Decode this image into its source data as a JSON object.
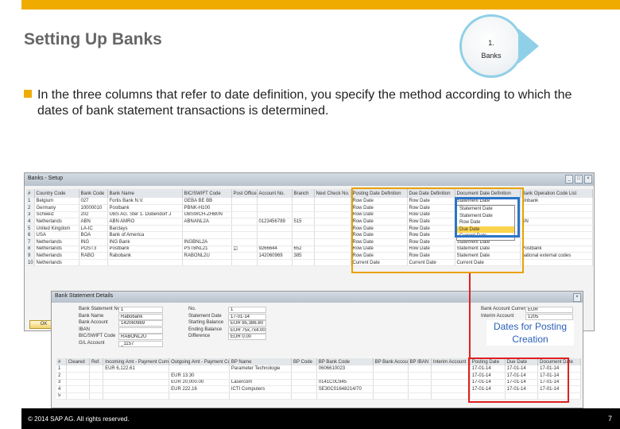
{
  "slide": {
    "title": "Setting Up Banks",
    "step_number": "1.",
    "step_label": "Banks",
    "bullet_text": "In the three columns that refer to date definition, you specify the method according to which the dates of bank statement transactions is determined.",
    "callout": "Dates for Posting Creation",
    "footer_left": "© 2014 SAP AG. All rights reserved.",
    "page_number": "7"
  },
  "colors": {
    "accent": "#f0ab00",
    "highlight_blue": "#2b74c7",
    "highlight_red": "#e02020",
    "callout_text": "#2b5fb7"
  },
  "banks_window": {
    "title": "Banks - Setup",
    "ok_label": "OK",
    "columns": [
      "#",
      "Country Code",
      "Bank Code",
      "Bank Name",
      "BIC/SWIFT Code",
      "Post Office",
      "Account No.",
      "Branch",
      "Next Check No.",
      "Posting Date Definition",
      "Due Date Definition",
      "Document Date Definition",
      "Bank Operation Code List"
    ],
    "rows": [
      [
        "1",
        "Belgium",
        "027",
        "Fortis Bank N.V.",
        "GEBA BE BB",
        "",
        "",
        "",
        "",
        "Row Date",
        "Row Date",
        "Statement Date",
        "Unbank"
      ],
      [
        "2",
        "Germany",
        "10000010",
        "Postbank",
        "PBNK-H100",
        "",
        "",
        "",
        "",
        "Row Date",
        "Row Date",
        "",
        ""
      ],
      [
        "3",
        "Schweiz",
        "202",
        "UBS AG. Ster 1. Dübendorf J",
        "UBSWCH-ZHB0N",
        "",
        "",
        "",
        "",
        "Row Date",
        "Row Date",
        "",
        ""
      ],
      [
        "4",
        "Netherlands",
        "ABN",
        "ABN AMRO",
        "ABNANL2A",
        "",
        "0123456789",
        "515",
        "",
        "Row Date",
        "Row Date",
        "",
        "SN"
      ],
      [
        "5",
        "United Kingdom",
        "LA-IC",
        "Barclays",
        "",
        "",
        "",
        "",
        "",
        "Row Date",
        "Row Date",
        "",
        ""
      ],
      [
        "6",
        "USA",
        "BOA",
        "Bank of America",
        "",
        "",
        "",
        "",
        "",
        "Row Date",
        "Row Date",
        "Statement Date",
        ""
      ],
      [
        "7",
        "Netherlands",
        "ING",
        "ING Bank",
        "INGBNL2A",
        "",
        "",
        "",
        "",
        "Row Date",
        "Row Date",
        "Statement Date",
        ""
      ],
      [
        "8",
        "Netherlands",
        "POST3",
        "Postbank",
        "PSTBNL21",
        "☑",
        "9266644",
        "652",
        "",
        "Row Date",
        "Row Date",
        "Statement Date",
        "Postbank"
      ],
      [
        "9",
        "Netherlands",
        "RABO",
        "Rabobank",
        "RABONL2U",
        "",
        "142060969",
        "385",
        "",
        "Row Date",
        "Row Date",
        "Statement Date",
        "national external codes"
      ],
      [
        "10",
        "Netherlands",
        "",
        "",
        "",
        "",
        "",
        "",
        "",
        "Current Date",
        "Current Date",
        "Current Date",
        ""
      ]
    ],
    "dropdown_options": [
      "Statement Date",
      "Statement Date",
      "Row Date",
      "Due Date",
      "Current Date"
    ],
    "dropdown_selected_index": 3
  },
  "statement_window": {
    "title": "Bank Statement Details",
    "left_fields": [
      {
        "label": "Bank Statement No.",
        "value": "1"
      },
      {
        "label": "Bank Name",
        "value": "Rabobank"
      },
      {
        "label": "Bank Account",
        "value": "142060969"
      },
      {
        "label": "IBAN",
        "value": ""
      },
      {
        "label": "BIC/SWIFT Code",
        "value": "RABONL2U"
      },
      {
        "label": "G/L Account",
        "value": "_1157"
      }
    ],
    "mid_fields": [
      {
        "label": "No.",
        "value": "1"
      },
      {
        "label": "Statement Date",
        "value": "17-01-14"
      },
      {
        "label": "Starting Balance",
        "value": "EUR 85,386.80"
      },
      {
        "label": "Ending Balance",
        "value": "EUR 75x,7x4.00"
      },
      {
        "label": "Difference",
        "value": "EUR 0.00"
      }
    ],
    "right_fields": [
      {
        "label": "Bank Account Currency",
        "value": "EUR"
      },
      {
        "label": "Interim Account",
        "value": "1205"
      }
    ],
    "columns": [
      "#",
      "Cleared",
      "Ref.",
      "Incoming Amt - Payment Currency",
      "Outgoing Amt - Payment Currency",
      "BP Name",
      "BP Code",
      "BP Bank Code",
      "BP Bank Account",
      "BP IBAN",
      "Interim Account",
      "Posting Date",
      "Due Date",
      "Document Date"
    ],
    "rows": [
      [
        "1",
        "",
        "",
        "EUR 6,122.61",
        "",
        "Parameter Technologie",
        "",
        "0606610023",
        "",
        "",
        "",
        "17-01-14",
        "17-01-14",
        "17-01-14"
      ],
      [
        "2",
        "",
        "",
        "",
        "EUR 13.30",
        "",
        "",
        "",
        "",
        "",
        "",
        "17-01-14",
        "17-01-14",
        "17-01-14"
      ],
      [
        "3",
        "",
        "",
        "",
        "EUR 20,000.00",
        "Lasercom",
        "",
        "0141C0C945",
        "",
        "",
        "",
        "17-01-14",
        "17-01-14",
        "17-01-14"
      ],
      [
        "4",
        "",
        "",
        "",
        "EUR 222.16",
        "ICTI Computers",
        "",
        "SE30C01648214/70",
        "",
        "",
        "",
        "17-01-14",
        "17-01-14",
        "17-01-14"
      ],
      [
        "5",
        "",
        "",
        "",
        "",
        "",
        "",
        "",
        "",
        "",
        "",
        "",
        "",
        ""
      ]
    ]
  }
}
